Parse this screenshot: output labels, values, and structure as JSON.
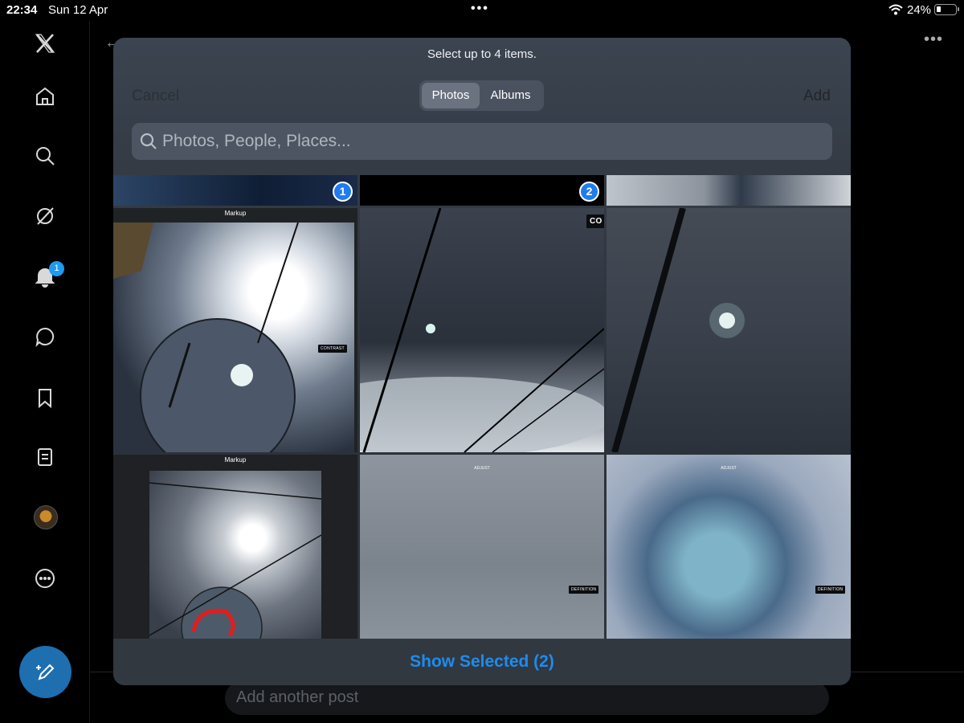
{
  "status_bar": {
    "time": "22:34",
    "date": "Sun 12 Apr",
    "battery": "24%"
  },
  "sidebar": {
    "items": [
      {
        "icon": "x-logo-icon"
      },
      {
        "icon": "home-icon"
      },
      {
        "icon": "search-icon"
      },
      {
        "icon": "grok-icon"
      },
      {
        "icon": "bell-icon"
      },
      {
        "icon": "message-icon"
      },
      {
        "icon": "bookmark-icon"
      },
      {
        "icon": "list-icon"
      },
      {
        "icon": "avatar"
      },
      {
        "icon": "more-icon"
      }
    ],
    "notification_count": "1"
  },
  "background": {
    "reply_placeholder": "Add another post"
  },
  "picker": {
    "title": "Select up to 4 items.",
    "cancel_label": "Cancel",
    "add_label": "Add",
    "tabs": {
      "photos": "Photos",
      "albums": "Albums",
      "active": "Photos"
    },
    "search_placeholder": "Photos, People, Places...",
    "selection_badges": [
      "1",
      "2"
    ],
    "thumb_labels": {
      "markup": "Markup",
      "adjust": "ADJUST",
      "contrast": "CONTRAST",
      "definition": "DEFINITION",
      "co": "CO"
    },
    "show_selected": "Show Selected (2)"
  },
  "colors": {
    "accent": "#1d9bf0",
    "selected_badge": "#1e7cf0"
  }
}
